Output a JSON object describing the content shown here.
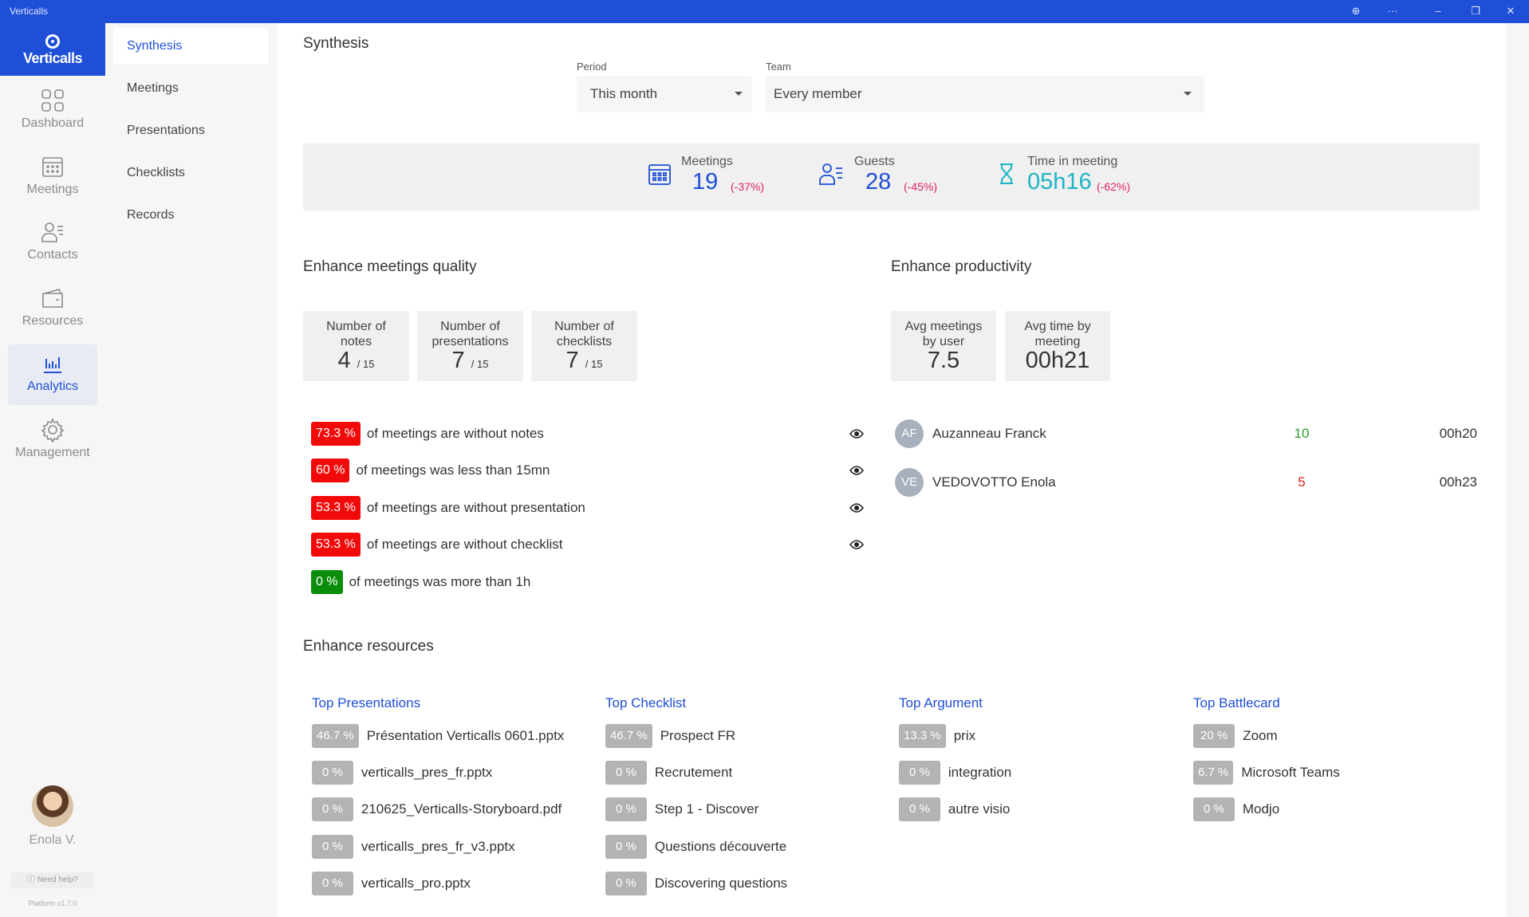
{
  "window": {
    "title": "Verticalls",
    "buttons": [
      "zoom",
      "more",
      "minimize",
      "restore",
      "close"
    ]
  },
  "logo": {
    "text": "Verticalls"
  },
  "nav": [
    {
      "label": "Dashboard",
      "icon": "grid-icon"
    },
    {
      "label": "Meetings",
      "icon": "calendar-icon"
    },
    {
      "label": "Contacts",
      "icon": "contact-icon"
    },
    {
      "label": "Resources",
      "icon": "folder-icon"
    },
    {
      "label": "Analytics",
      "icon": "chart-icon",
      "active": true
    },
    {
      "label": "Management",
      "icon": "gear-icon"
    }
  ],
  "user": {
    "name": "Enola V.",
    "help": "Need help?",
    "platform": "Platform v1.7.0"
  },
  "subnav": [
    "Synthesis",
    "Meetings",
    "Presentations",
    "Checklists",
    "Records"
  ],
  "page": {
    "title": "Synthesis"
  },
  "filters": {
    "period_label": "Period",
    "period_value": "This month",
    "team_label": "Team",
    "team_value": "Every member"
  },
  "kpis": [
    {
      "label": "Meetings",
      "value": "19",
      "delta": "(-37%)",
      "icon": "calendar-icon"
    },
    {
      "label": "Guests",
      "value": "28",
      "delta": "(-45%)",
      "icon": "guests-icon"
    },
    {
      "label": "Time in meeting",
      "value": "05h16",
      "delta": "(-62%)",
      "icon": "hourglass-icon"
    }
  ],
  "quality": {
    "title": "Enhance meetings quality",
    "cards": [
      {
        "label": "Number of notes",
        "value": "4",
        "total": "/ 15"
      },
      {
        "label": "Number of presentations",
        "value": "7",
        "total": "/ 15"
      },
      {
        "label": "Number of checklists",
        "value": "7",
        "total": "/ 15"
      }
    ],
    "rows": [
      {
        "pct": "73.3 %",
        "text": "of meetings are without notes",
        "color": "red",
        "eye": true
      },
      {
        "pct": "60 %",
        "text": "of meetings was less than 15mn",
        "color": "red",
        "eye": true
      },
      {
        "pct": "53.3 %",
        "text": "of meetings are without presentation",
        "color": "red",
        "eye": true
      },
      {
        "pct": "53.3 %",
        "text": "of meetings are without checklist",
        "color": "red",
        "eye": true
      },
      {
        "pct": "0 %",
        "text": "of meetings was more than 1h",
        "color": "green",
        "eye": false
      }
    ]
  },
  "productivity": {
    "title": "Enhance productivity",
    "cards": [
      {
        "label": "Avg meetings by user",
        "value": "7.5"
      },
      {
        "label": "Avg time by meeting",
        "value": "00h21"
      }
    ],
    "users": [
      {
        "initials": "AF",
        "name": "Auzanneau Franck",
        "count": "10",
        "count_color": "#2e9a2e",
        "time": "00h20"
      },
      {
        "initials": "VE",
        "name": "VEDOVOTTO Enola",
        "count": "5",
        "count_color": "#e02424",
        "time": "00h23"
      }
    ]
  },
  "resources": {
    "title": "Enhance resources",
    "columns": [
      {
        "title": "Top Presentations",
        "items": [
          {
            "pct": "46.7 %",
            "name": "Présentation Verticalls 0601.pptx"
          },
          {
            "pct": "0 %",
            "name": "verticalls_pres_fr.pptx"
          },
          {
            "pct": "0 %",
            "name": "210625_Verticalls-Storyboard.pdf"
          },
          {
            "pct": "0 %",
            "name": "verticalls_pres_fr_v3.pptx"
          },
          {
            "pct": "0 %",
            "name": "verticalls_pro.pptx"
          }
        ]
      },
      {
        "title": "Top Checklist",
        "items": [
          {
            "pct": "46.7 %",
            "name": "Prospect FR"
          },
          {
            "pct": "0 %",
            "name": "Recrutement"
          },
          {
            "pct": "0 %",
            "name": "Step 1 - Discover"
          },
          {
            "pct": "0 %",
            "name": "Questions découverte"
          },
          {
            "pct": "0 %",
            "name": "Discovering questions"
          }
        ]
      },
      {
        "title": "Top Argument",
        "items": [
          {
            "pct": "13.3 %",
            "name": "prix"
          },
          {
            "pct": "0 %",
            "name": "integration"
          },
          {
            "pct": "0 %",
            "name": "autre visio"
          }
        ]
      },
      {
        "title": "Top Battlecard",
        "items": [
          {
            "pct": "20 %",
            "name": "Zoom"
          },
          {
            "pct": "6.7 %",
            "name": "Microsoft Teams"
          },
          {
            "pct": "0 %",
            "name": "Modjo"
          }
        ]
      }
    ]
  },
  "colors": {
    "brand": "#1e4fd6",
    "danger": "#f20a0a",
    "success": "#0a8d0a",
    "neutral": "#b3b3b3",
    "kpi_time": "#1cb5c5",
    "delta": "#e0245e"
  }
}
